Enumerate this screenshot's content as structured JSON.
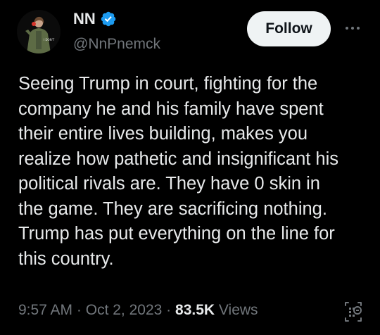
{
  "author": {
    "display_name": "NN",
    "handle": "@NnPnemck",
    "verified": true,
    "avatar_description": "person-in-green-jacket"
  },
  "actions": {
    "follow_label": "Follow",
    "more_icon": "more-horizontal-icon",
    "analytics_icon": "analytics-icon"
  },
  "tweet": {
    "text": "Seeing Trump in court, fighting for the\ncompany he and his family have spent\ntheir entire lives building, makes you\nrealize how pathetic and insignificant his\npolitical rivals are. They have 0 skin in\nthe game. They are sacrificing nothing.\nTrump has put everything on the line for\nthis country.",
    "time": "9:57 AM",
    "separator": "·",
    "date": "Oct 2, 2023",
    "views_count": "83.5K",
    "views_label": "Views"
  },
  "colors": {
    "background": "#000000",
    "text_primary": "#e7e9ea",
    "text_secondary": "#71767b",
    "verified_blue": "#1d9bf0",
    "follow_bg": "#eff3f4"
  }
}
